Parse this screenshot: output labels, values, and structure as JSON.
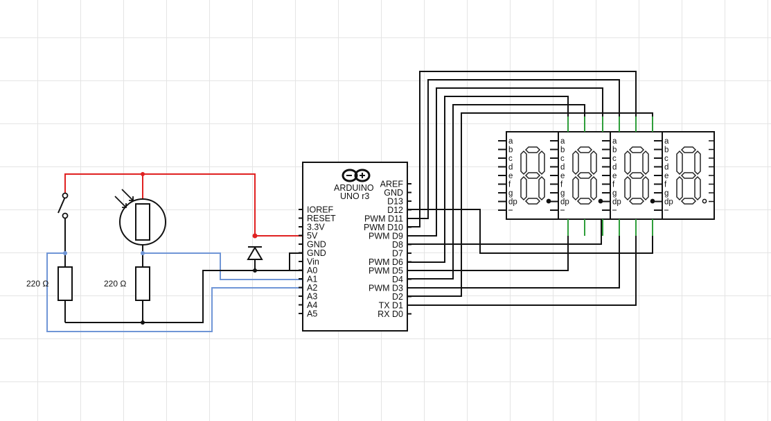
{
  "arduino": {
    "brand": "ARDUINO",
    "model": "UNO r3",
    "left_pins": [
      "IOREF",
      "RESET",
      "3.3V",
      "5V",
      "GND",
      "GND",
      "Vin",
      "A0",
      "A1",
      "A2",
      "A3",
      "A4",
      "A5"
    ],
    "right_pins": [
      "AREF",
      "GND",
      "D13",
      "D12",
      "PWM D11",
      "PWM D10",
      "PWM D9",
      "D8",
      "D7",
      "PWM D6",
      "PWM D5",
      "D4",
      "PWM D3",
      "D2",
      "TX D1",
      "RX D0"
    ]
  },
  "resistors": {
    "left_value": "220 Ω",
    "mid_value": "220 Ω"
  },
  "display": {
    "segments": [
      "a",
      "b",
      "c",
      "d",
      "e",
      "f",
      "g",
      "dp"
    ],
    "digit_count": 4
  },
  "colors": {
    "power": "#e02020",
    "signal": "#6f95d6",
    "digit": "#2e9e3a",
    "wire": "#111111"
  }
}
